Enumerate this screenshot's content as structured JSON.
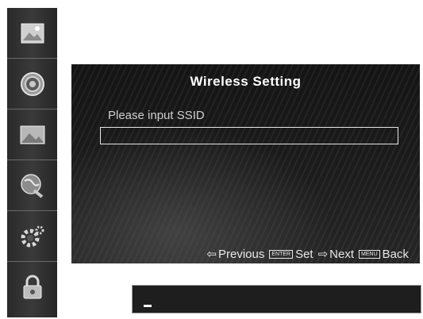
{
  "sidebar": {
    "items": [
      {
        "name": "picture-menu",
        "icon": "picture-icon"
      },
      {
        "name": "sound-menu",
        "icon": "speaker-icon"
      },
      {
        "name": "screen-menu",
        "icon": "landscape-icon"
      },
      {
        "name": "network-menu",
        "icon": "globe-icon"
      },
      {
        "name": "setup-menu",
        "icon": "gears-icon"
      },
      {
        "name": "lock-menu",
        "icon": "lock-icon"
      }
    ]
  },
  "dialog": {
    "title": "Wireless Setting",
    "prompt": "Please input SSID",
    "ssid_value": ""
  },
  "hints": {
    "previous_arrow": "⇦",
    "previous_label": "Previous",
    "enter_key": "ENTER",
    "set_label": "Set",
    "next_arrow": "⇨",
    "next_label": "Next",
    "menu_key": "MENU",
    "back_label": "Back"
  },
  "colors": {
    "panel_background": "#1c1c1c",
    "text": "#ffffff",
    "sidebar": "#333333"
  }
}
